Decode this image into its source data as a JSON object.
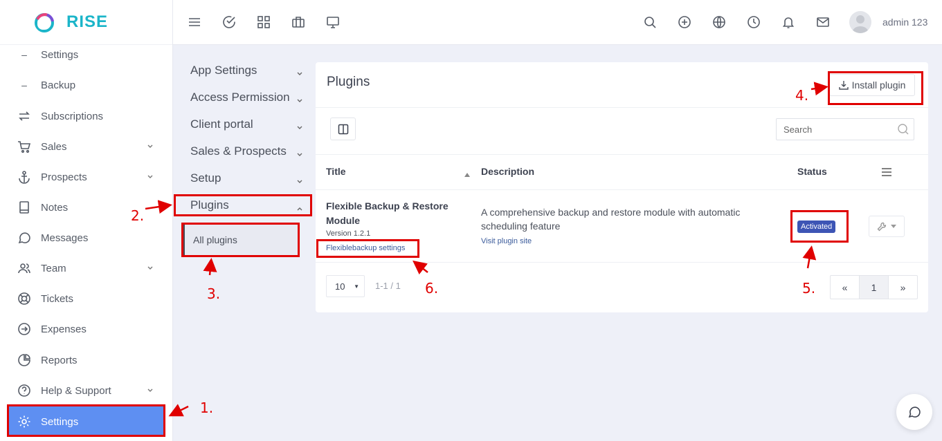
{
  "brand": {
    "name": "RISE"
  },
  "sidebar": {
    "items": [
      {
        "label": "Settings",
        "sub": true
      },
      {
        "label": "Backup",
        "sub": true
      },
      {
        "label": "Subscriptions"
      },
      {
        "label": "Sales",
        "expandable": true
      },
      {
        "label": "Prospects",
        "expandable": true
      },
      {
        "label": "Notes"
      },
      {
        "label": "Messages"
      },
      {
        "label": "Team",
        "expandable": true
      },
      {
        "label": "Tickets"
      },
      {
        "label": "Expenses"
      },
      {
        "label": "Reports"
      },
      {
        "label": "Help & Support",
        "expandable": true
      },
      {
        "label": "Settings",
        "active": true
      }
    ]
  },
  "topbar": {
    "icons": [
      "menu-icon",
      "check-circle-icon",
      "grid-icon",
      "briefcase-icon",
      "monitor-icon",
      "search-icon",
      "plus-circle-icon",
      "globe-icon",
      "clock-icon",
      "bell-icon",
      "mail-icon"
    ],
    "username": "admin 123"
  },
  "settings_menu": {
    "items": [
      "App Settings",
      "Access Permission",
      "Client portal",
      "Sales & Prospects",
      "Setup",
      "Plugins"
    ],
    "sub_item": "All plugins"
  },
  "plugins": {
    "title": "Plugins",
    "install_label": "Install plugin",
    "search_placeholder": "Search",
    "columns": {
      "title": "Title",
      "description": "Description",
      "status": "Status"
    },
    "row": {
      "name": "Flexible Backup & Restore Module",
      "version": "Version 1.2.1",
      "settings_link": "Flexiblebackup settings",
      "description": "A comprehensive backup and restore module with automatic scheduling feature",
      "visit_link": "Visit plugin site",
      "status": "Activated"
    },
    "pagination": {
      "per_page": "10",
      "range": "1-1 / 1",
      "first": "«",
      "current": "1",
      "last": "»"
    }
  },
  "annotations": [
    "1.",
    "2.",
    "3.",
    "4.",
    "5.",
    "6."
  ],
  "colors": {
    "accent": "#5e8ff2",
    "brand": "#1bb5c9",
    "badge": "#3d55b5",
    "annotation": "#e00000"
  }
}
